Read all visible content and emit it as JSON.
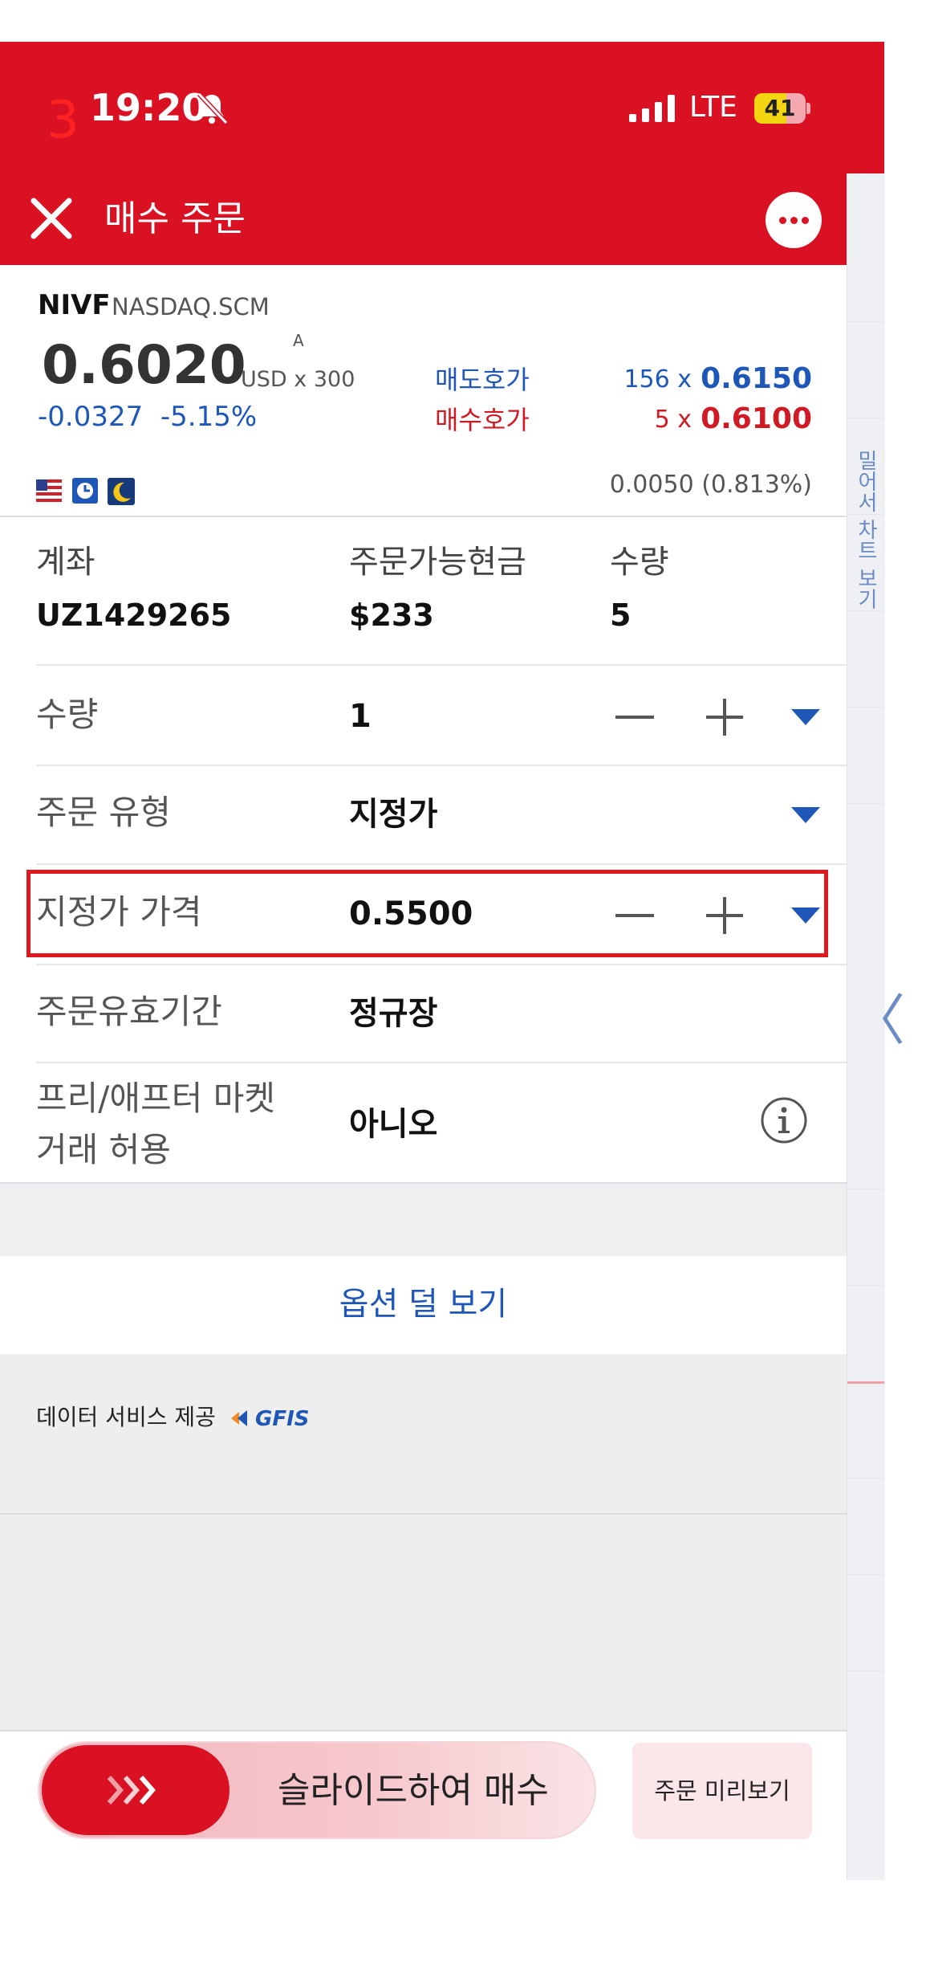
{
  "status_bar": {
    "annotation_number": "3",
    "time": "19:20",
    "network": "LTE",
    "battery": "41"
  },
  "header": {
    "title": "매수 주문",
    "accent_color": "#da1023"
  },
  "quote": {
    "symbol": "NIVF",
    "exchange": "NASDAQ.SCM",
    "price": "0.6020",
    "tick_marker": "A",
    "currency_qty": "USD x 300",
    "change": "-0.0327",
    "change_pct": "-5.15%",
    "ask_label": "매도호가",
    "ask_size": "156 x",
    "ask_price": "0.6150",
    "bid_label": "매수호가",
    "bid_size": "5 x",
    "bid_price": "0.6100",
    "spread": "0.0050 (0.813%)",
    "icons": [
      "us-flag-icon",
      "clock-icon",
      "moon-icon"
    ]
  },
  "account": {
    "account_label": "계좌",
    "account_value": "UZ1429265",
    "cash_label": "주문가능현금",
    "cash_value": "$233",
    "qty_label": "수량",
    "qty_value": "5"
  },
  "form": {
    "quantity": {
      "label": "수량",
      "value": "1"
    },
    "order_type": {
      "label": "주문 유형",
      "value": "지정가"
    },
    "limit_price": {
      "label": "지정가 가격",
      "value": "0.5500"
    },
    "time_in_force": {
      "label": "주문유효기간",
      "value": "정규장"
    },
    "extended_hours": {
      "label_line1": "프리/애프터 마켓",
      "label_line2": "거래 허용",
      "value": "아니오"
    }
  },
  "more_options": "옵션 덜 보기",
  "data_provider": {
    "label": "데이터 서비스 제공",
    "logo": "GFIS"
  },
  "side_panel": {
    "label": "밀어서 차트 보기"
  },
  "bottom": {
    "slide_label": "슬라이드하여 매수",
    "preview_label": "주문 미리보기"
  }
}
